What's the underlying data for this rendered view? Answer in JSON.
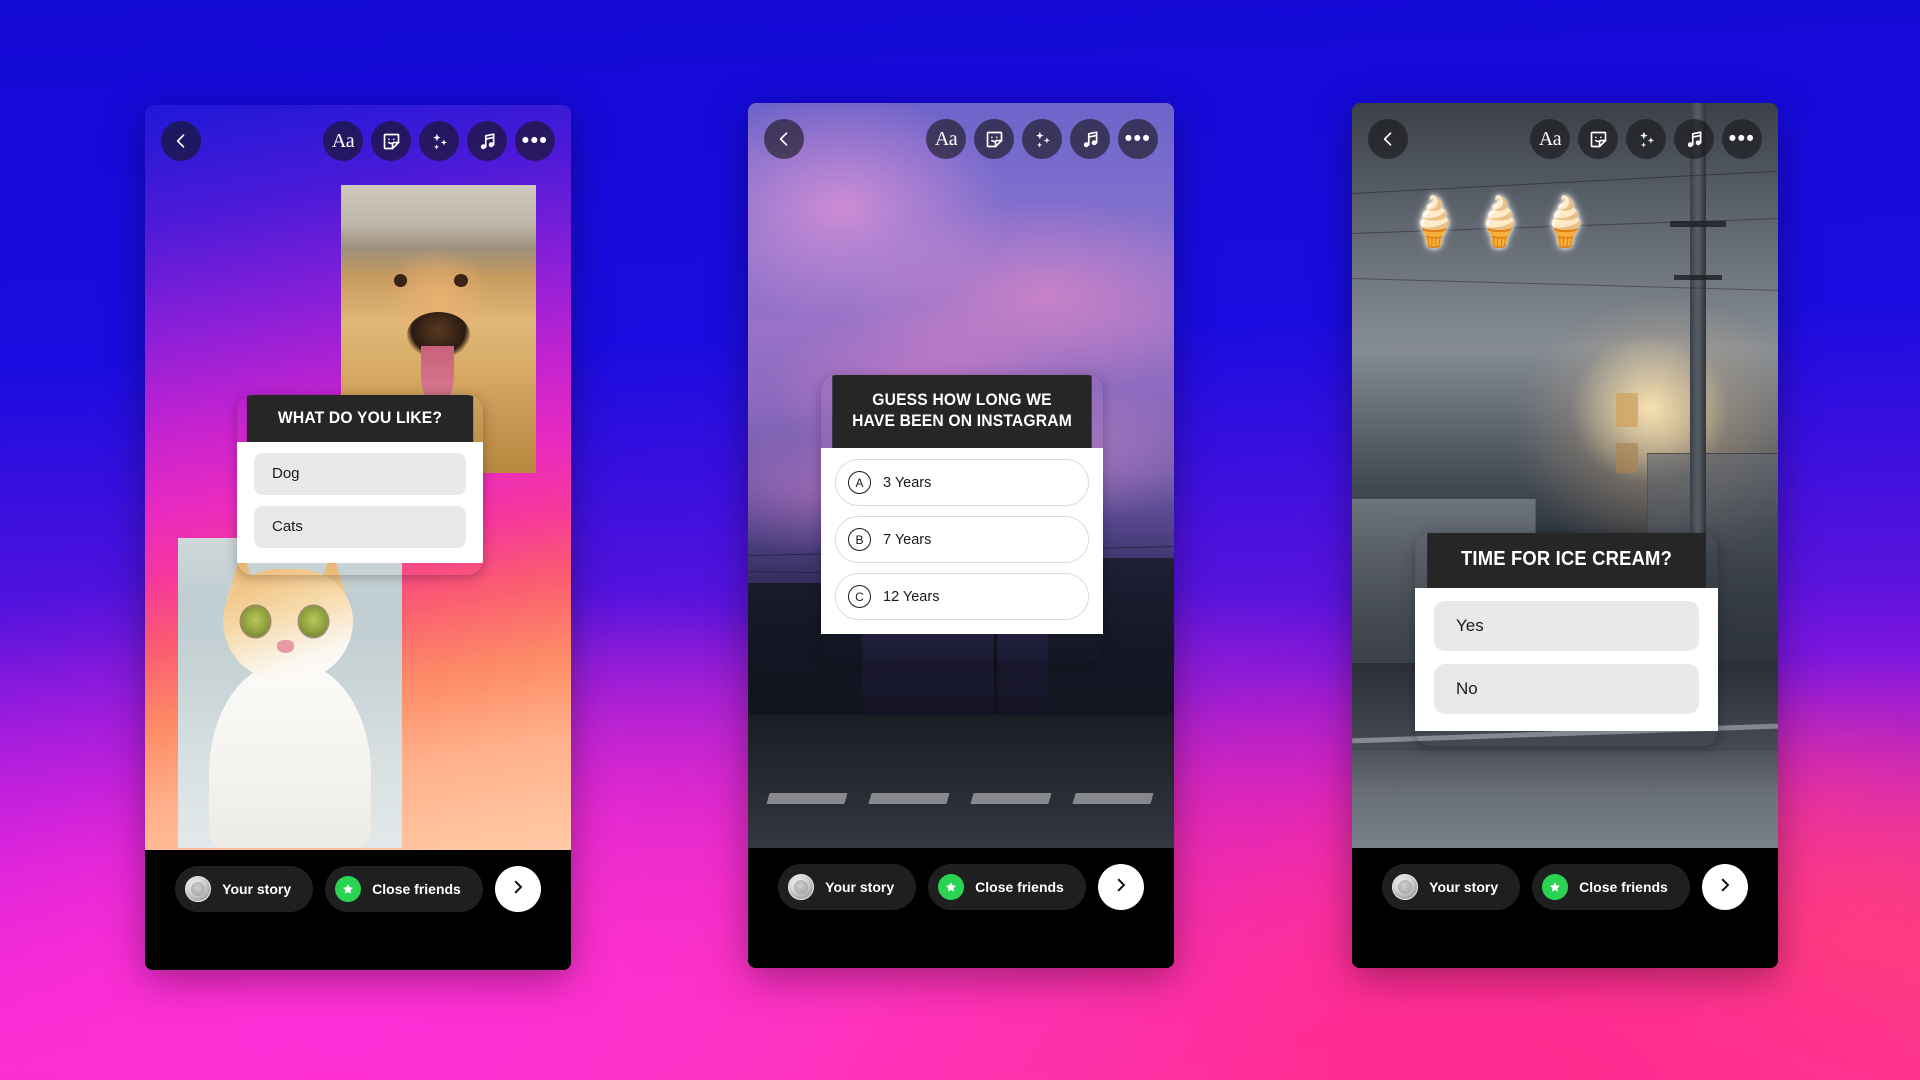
{
  "background": {
    "top_color": "#1309d6",
    "mid_color": "#8a1fd8",
    "bottom_left_color": "#f02ae8",
    "bottom_right_color": "#ff2a8f"
  },
  "toolbar": {
    "back_label": "Back",
    "items": [
      {
        "name": "text-tool",
        "label": "Aa",
        "icon": "text-icon"
      },
      {
        "name": "sticker-tool",
        "label": "",
        "icon": "sticker-smiley-icon"
      },
      {
        "name": "effects-tool",
        "label": "",
        "icon": "sparkles-icon"
      },
      {
        "name": "music-tool",
        "label": "",
        "icon": "music-note-icon"
      },
      {
        "name": "more-tool",
        "label": "",
        "icon": "more-horizontal-icon"
      }
    ]
  },
  "bottom_bar": {
    "your_story_label": "Your story",
    "close_friends_label": "Close friends",
    "next_label": "Next",
    "close_friends_color": "#2ad452"
  },
  "phones": [
    {
      "id": "phone-poll",
      "name": "story-poll-dog-cat",
      "widget": {
        "type": "poll",
        "question": "WHAT DO YOU LIKE?",
        "options": [
          {
            "label": "Dog",
            "style": "filled"
          },
          {
            "label": "Cats",
            "style": "filled"
          }
        ]
      },
      "photos": [
        {
          "name": "dog-photo",
          "alt": "Golden retriever dog"
        },
        {
          "name": "cat-photo",
          "alt": "Orange and white cat"
        }
      ]
    },
    {
      "id": "phone-quiz",
      "name": "story-quiz-instagram",
      "widget": {
        "type": "quiz",
        "question": "GUESS HOW LONG WE HAVE BEEN ON INSTAGRAM",
        "options": [
          {
            "letter": "A",
            "label": "3 Years",
            "style": "outline"
          },
          {
            "letter": "B",
            "label": "7 Years",
            "style": "outline"
          },
          {
            "letter": "C",
            "label": "12 Years",
            "style": "outline"
          }
        ]
      },
      "photos": []
    },
    {
      "id": "phone-icecream",
      "name": "story-poll-ice-cream",
      "widget": {
        "type": "poll",
        "question": "TIME FOR ICE CREAM?",
        "options": [
          {
            "label": "Yes",
            "style": "filled"
          },
          {
            "label": "No",
            "style": "filled"
          }
        ]
      },
      "stickers": {
        "name": "ice-cream-emoji-row",
        "emojis": [
          "🍦",
          "🍦",
          "🍦"
        ]
      }
    }
  ]
}
